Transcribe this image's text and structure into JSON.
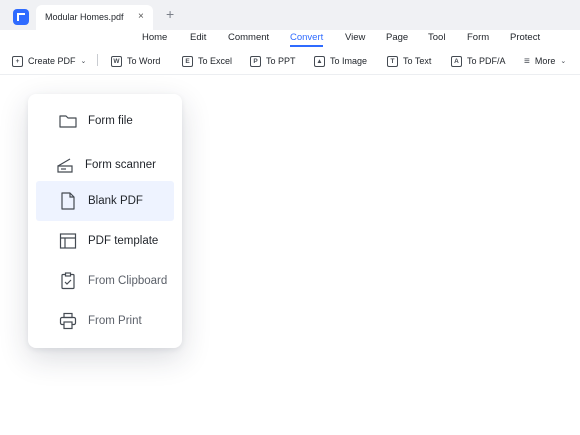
{
  "titlebar": {
    "tab_title": "Modular Homes.pdf",
    "close_glyph": "×",
    "new_tab_glyph": "+"
  },
  "menu": {
    "items": [
      "Home",
      "Edit",
      "Comment",
      "Convert",
      "View",
      "Page",
      "Tool",
      "Form",
      "Protect"
    ],
    "active": "Convert"
  },
  "toolbar": {
    "create_pdf": "Create PDF",
    "to_word": "To Word",
    "to_excel": "To Excel",
    "to_ppt": "To PPT",
    "to_image": "To Image",
    "to_text": "To Text",
    "to_pdfa": "To PDF/A",
    "more": "More"
  },
  "create_menu": {
    "items": [
      {
        "label": "Form file",
        "icon": "folder-icon"
      },
      {
        "label": "Form scanner",
        "icon": "scanner-icon"
      },
      {
        "label": "Blank PDF",
        "icon": "blank-page-icon",
        "selected": true
      },
      {
        "label": "PDF template",
        "icon": "template-icon"
      },
      {
        "label": "From Clipboard",
        "icon": "clipboard-icon"
      },
      {
        "label": "From Print",
        "icon": "printer-icon"
      }
    ]
  },
  "colors": {
    "accent": "#2f6bff",
    "selected_bg": "#eef3ff",
    "titlebar_bg": "#f0f1f4"
  }
}
